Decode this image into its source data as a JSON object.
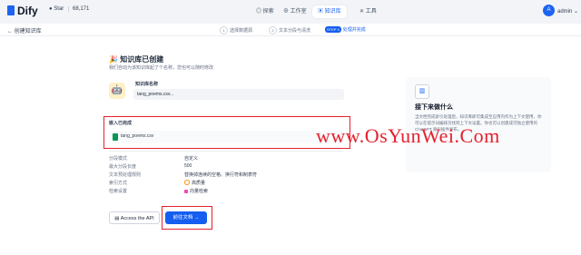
{
  "header": {
    "brand": "Dify",
    "star_label": "Star",
    "star_count": "68,171",
    "nav": [
      {
        "label": "探索",
        "icon": "compass-icon"
      },
      {
        "label": "工作室",
        "icon": "studio-icon"
      },
      {
        "label": "知识库",
        "icon": "knowledge-icon",
        "active": true
      },
      {
        "label": "工具",
        "icon": "tool-icon"
      }
    ],
    "avatar_letter": "A",
    "user_name": "admin"
  },
  "subbar": {
    "back_label": "创建知识库",
    "steps": [
      {
        "num": "1",
        "label": "选择数据源"
      },
      {
        "num": "2",
        "label": "文本分段与清洗"
      },
      {
        "num": "STEP 3",
        "label": "处理并完成"
      }
    ]
  },
  "main": {
    "title": "知识库已创建",
    "title_emoji": "🎉",
    "subtitle": "我们自动为该知识库起了个名称，您也可以随时修改",
    "dataset_name_label": "知识库名称",
    "dataset_name_value": "tang_poems.csv...",
    "embedded_label": "嵌入已完成",
    "file_name": "tang_poems.csv",
    "settings": [
      {
        "key": "分段模式",
        "value": "自定义"
      },
      {
        "key": "最大分段长度",
        "value": "500"
      },
      {
        "key": "文本预处理规则",
        "value": "替换掉连续的空格、换行符和制表符"
      },
      {
        "key": "索引方式",
        "value": "高质量"
      },
      {
        "key": "检索设置",
        "value": "向量检索"
      }
    ],
    "access_api_label": "Access the API",
    "go_doc_label": "前往文档"
  },
  "panel": {
    "title": "接下来做什么",
    "text": "当文档完成索引处理后，知识库即可集成至应用内作为上下文使用，你可以在提示词编排页找到上下文设置。你也可以创建成可独立使用的 ChatGPT 索引插件发布。"
  },
  "watermark": "www.OsYunWei.Com",
  "colors": {
    "accent": "#155eef",
    "highlight": "#e5202e"
  }
}
